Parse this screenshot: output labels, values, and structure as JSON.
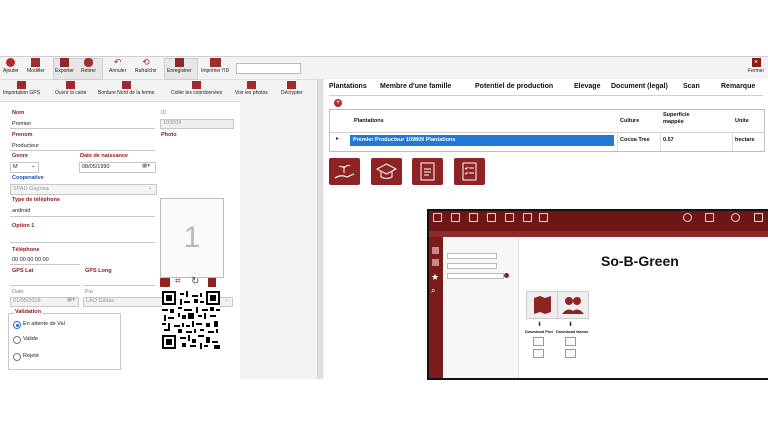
{
  "toolbar": {
    "ajouter": "Ajouter",
    "modifier": "Modifier",
    "exporter": "Exporter",
    "retirer": "Retirer",
    "annuler": "Annuler",
    "rafraichir": "Rafraîchir",
    "enregistrer": "Enregistrer",
    "imprimer_id": "Imprimer l'ID",
    "fermer": "Fermer"
  },
  "actions": {
    "importation_gps": "Importation GPS",
    "ouvrir_carte": "Ouvrir la carte",
    "bordure_nord": "Bordure Nord de la ferme",
    "coller_coordonnees": "Coller les coordonnées",
    "voir_photos": "Voir les photos",
    "decrypter": "Décrypter"
  },
  "form": {
    "nom_label": "Nom",
    "nom_value": "Premier",
    "id_label": "ID",
    "id_value": "109809",
    "prenom_label": "Prenom",
    "prenom_value": "Producteur",
    "photo_label": "Photo",
    "photo_placeholder": "1",
    "genre_label": "Genre",
    "genre_value": "M",
    "dob_label": "Date de naissance",
    "dob_value": "08/05/1990",
    "coop_label": "Cooperative",
    "coop_value": "SPAD Gagnoa",
    "phone_type_label": "Type de téléphone",
    "phone_type_value": "android",
    "option_label": "Option 1",
    "telephone_label": "Téléphone",
    "telephone_value": "00 00 00 00 00",
    "gps_lat_label": "GPS Lat",
    "gps_long_label": "GPS Long",
    "date_label": "Date",
    "date_value": "01/05/2018",
    "par_label": "Par",
    "par_value": "LAO Gildas",
    "validation_label": "Validation",
    "radio_attente": "En attente de Val",
    "radio_valide": "Valide",
    "radio_rejete": "Rejeté"
  },
  "tabs": [
    "Plantations",
    "Membre d'une famille",
    "Potentiel de production",
    "Elevage",
    "Document (legal)",
    "Scan",
    "Remarque"
  ],
  "grid": {
    "headers": [
      "Plantations",
      "Culture",
      "Superficie mappée",
      "Unite"
    ],
    "row": {
      "plantations": "Premier Producteur  109809  Plantations",
      "culture": "Cocoa Tree",
      "superficie": "0.57",
      "unite": "hectare"
    }
  },
  "overlay": {
    "title": "So-B-Green",
    "download_plot": "Download Plot",
    "download_farmer": "Download farmer"
  },
  "colors": {
    "brand": "#8d2323",
    "selection": "#1e7ad6"
  }
}
